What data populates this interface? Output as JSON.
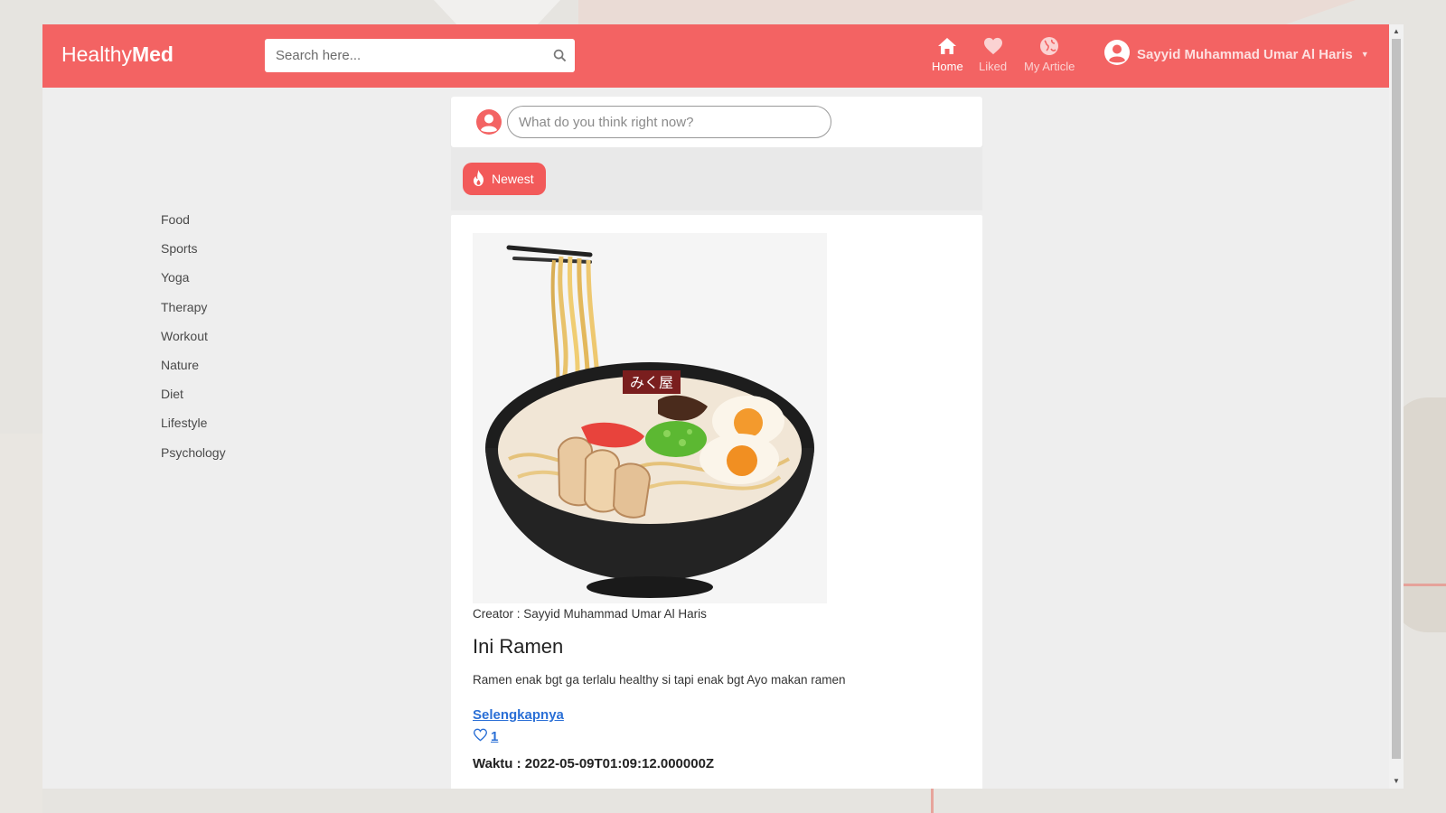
{
  "brand": {
    "prefix": "Healthy",
    "suffix": "Med"
  },
  "search": {
    "placeholder": "Search here..."
  },
  "nav": {
    "home": "Home",
    "liked": "Liked",
    "my_article": "My Article"
  },
  "user": {
    "name": "Sayyid Muhammad Umar Al Haris"
  },
  "composer": {
    "placeholder": "What do you think right now?"
  },
  "sort": {
    "label": "Newest"
  },
  "categories": [
    "Food",
    "Sports",
    "Yoga",
    "Therapy",
    "Workout",
    "Nature",
    "Diet",
    "Lifestyle",
    "Psychology"
  ],
  "article": {
    "creator": "Creator : Sayyid Muhammad Umar Al Haris",
    "title": "Ini Ramen",
    "description": "Ramen enak bgt ga terlalu healthy si tapi enak bgt Ayo makan ramen",
    "read_more": "Selengkapnya",
    "likes": "1",
    "time": "Waktu : 2022-05-09T01:09:12.000000Z",
    "bowl_label": "みく屋"
  },
  "colors": {
    "primary": "#f36363",
    "link": "#2a6fd6",
    "background": "#eeeeee"
  }
}
